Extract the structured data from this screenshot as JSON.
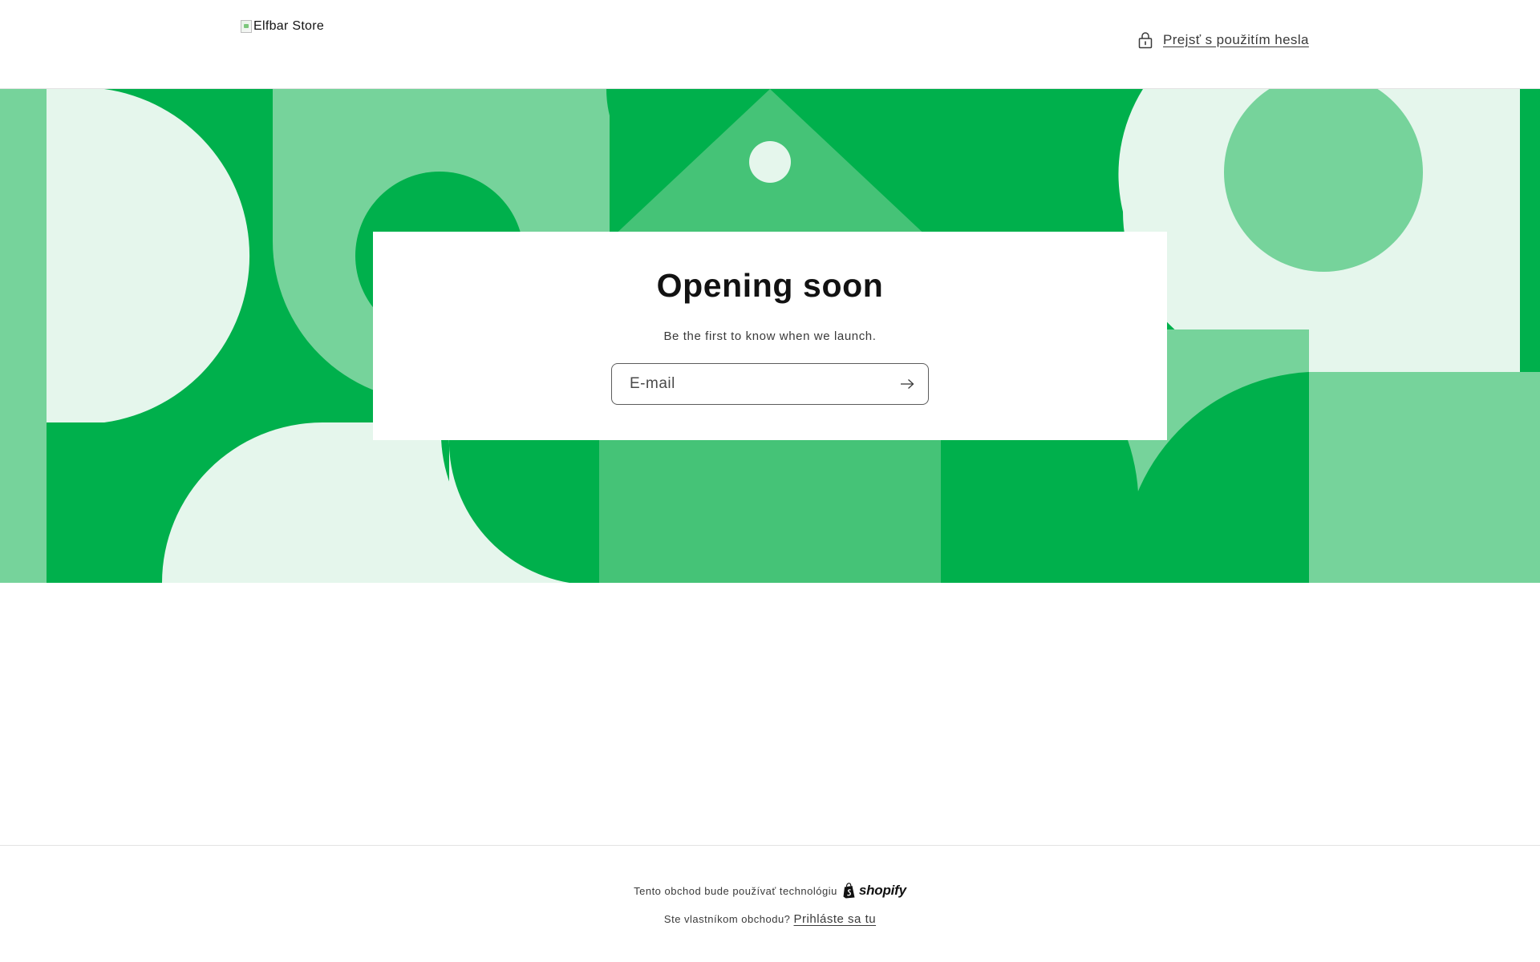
{
  "header": {
    "logo_alt": "Elfbar Store",
    "password_link": "Prejsť s použitím hesla",
    "lock_icon": "lock-icon"
  },
  "hero": {
    "colors": {
      "dark_green": "#00b04c",
      "medium_green": "#45c377",
      "light_green": "#76d39b",
      "pale_green": "#e5f6ec"
    },
    "title": "Opening soon",
    "subtitle": "Be the first to know when we launch.",
    "email": {
      "placeholder": "E-mail",
      "value": ""
    },
    "submit_icon": "arrow-right-icon"
  },
  "footer": {
    "powered_text": "Tento obchod bude používať technológiu",
    "shopify_label": "shopify",
    "owner_text": "Ste vlastníkom obchodu?",
    "login_link": "Prihláste sa tu"
  }
}
